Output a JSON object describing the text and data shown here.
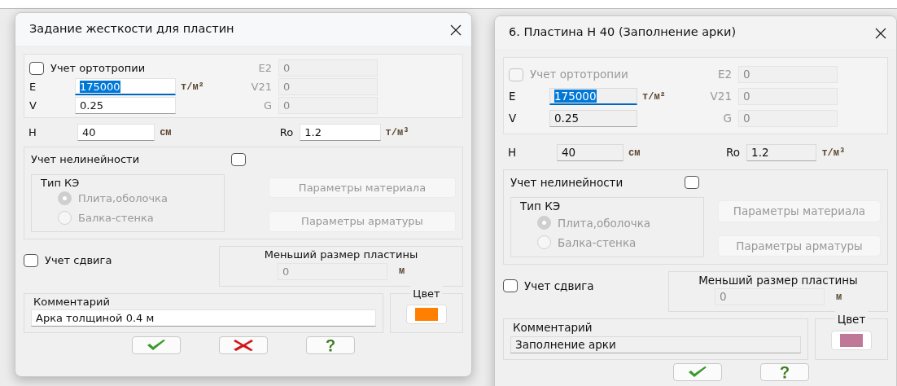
{
  "dialogs": [
    {
      "title": "Задание жесткости для пластин",
      "read_only": false,
      "orthotropy": {
        "label": "Учет ортотропии",
        "checked": false,
        "disabled": false
      },
      "material_rows": [
        {
          "label": "E",
          "value": "175000",
          "unit": "т/м²",
          "selected": true,
          "right": {
            "label": "E2",
            "value": "0",
            "disabled": true
          }
        },
        {
          "label": "V",
          "value": "0.25",
          "selected": false,
          "right": {
            "label": "V21",
            "value": "0",
            "disabled": true
          }
        },
        {
          "right": {
            "label": "G",
            "value": "0",
            "disabled": true
          }
        }
      ],
      "h_row": {
        "label": "H",
        "value": "40",
        "unit": "см",
        "right_label": "Ro",
        "right_value": "1.2",
        "right_unit": "т/м³"
      },
      "nonlinearity": {
        "label": "Учет нелинейности",
        "checked": false
      },
      "fe_type": {
        "title": "Тип КЭ",
        "disabled": true,
        "options": [
          {
            "label": "Плита,оболочка",
            "selected": true
          },
          {
            "label": "Балка-стенка",
            "selected": false
          }
        ]
      },
      "param_buttons": [
        {
          "label": "Параметры материала",
          "disabled": true
        },
        {
          "label": "Параметры арматуры",
          "disabled": true
        }
      ],
      "shear": {
        "label": "Учет сдвига",
        "checked": false
      },
      "min_size": {
        "title": "Меньший размер пластины",
        "value": "0",
        "unit": "м",
        "disabled": true
      },
      "comment": {
        "title": "Комментарий",
        "value": "Арка толщиной 0.4 м"
      },
      "color_group": {
        "title": "Цвет",
        "color": "#ff8000"
      },
      "buttons": [
        {
          "kind": "ok"
        },
        {
          "kind": "cancel"
        },
        {
          "kind": "help"
        }
      ]
    },
    {
      "title": "6. Пластина  Н 40 (Заполнение арки)",
      "read_only": true,
      "orthotropy": {
        "label": "Учет ортотропии",
        "checked": false,
        "disabled": true
      },
      "material_rows": [
        {
          "label": "E",
          "value": "175000",
          "unit": "т/м²",
          "selected": true,
          "right": {
            "label": "E2",
            "value": "0",
            "disabled": true
          }
        },
        {
          "label": "V",
          "value": "0.25",
          "selected": false,
          "right": {
            "label": "V21",
            "value": "0",
            "disabled": true
          }
        },
        {
          "right": {
            "label": "G",
            "value": "0",
            "disabled": true
          }
        }
      ],
      "h_row": {
        "label": "H",
        "value": "40",
        "unit": "см",
        "right_label": "Ro",
        "right_value": "1.2",
        "right_unit": "т/м³"
      },
      "nonlinearity": {
        "label": "Учет нелинейности",
        "checked": false
      },
      "fe_type": {
        "title": "Тип КЭ",
        "disabled": true,
        "options": [
          {
            "label": "Плита,оболочка",
            "selected": true
          },
          {
            "label": "Балка-стенка",
            "selected": false
          }
        ]
      },
      "param_buttons": [
        {
          "label": "Параметры материала",
          "disabled": true
        },
        {
          "label": "Параметры арматуры",
          "disabled": true
        }
      ],
      "shear": {
        "label": "Учет сдвига",
        "checked": false
      },
      "min_size": {
        "title": "Меньший размер пластины",
        "value": "0",
        "unit": "м",
        "disabled": true
      },
      "comment": {
        "title": "Комментарий",
        "value": "Заполнение арки"
      },
      "color_group": {
        "title": "Цвет",
        "color": "#c07898"
      },
      "buttons": [
        {
          "kind": "ok"
        },
        {
          "kind": "help"
        }
      ]
    }
  ]
}
